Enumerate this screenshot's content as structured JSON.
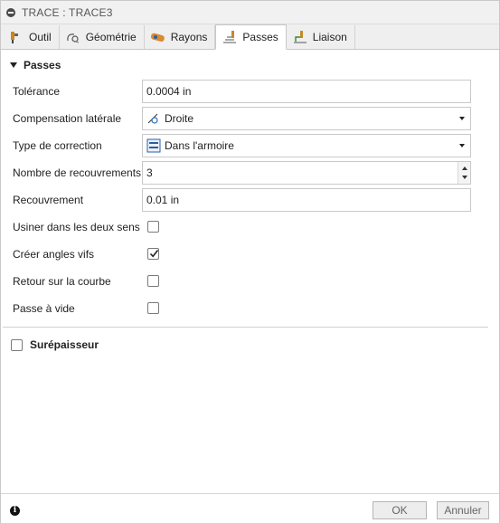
{
  "window": {
    "title": "TRACE : TRACE3"
  },
  "tabs": [
    {
      "label": "Outil",
      "icon": "tool-icon"
    },
    {
      "label": "Géométrie",
      "icon": "geometry-icon"
    },
    {
      "label": "Rayons",
      "icon": "radius-icon"
    },
    {
      "label": "Passes",
      "icon": "passes-icon",
      "active": true
    },
    {
      "label": "Liaison",
      "icon": "linking-icon"
    }
  ],
  "section": {
    "title": "Passes",
    "expanded": true
  },
  "fields": {
    "tolerance": {
      "label": "Tolérance",
      "value": "0.0004 in"
    },
    "compensation": {
      "label": "Compensation latérale",
      "value": "Droite",
      "icon": "compensation-right-icon"
    },
    "correction_type": {
      "label": "Type de correction",
      "value": "Dans l'armoire",
      "icon": "control-cabinet-icon"
    },
    "overlap_count": {
      "label": "Nombre de recouvrements",
      "value": "3"
    },
    "overlap": {
      "label": "Recouvrement",
      "value": "0.01 in"
    }
  },
  "checkboxes": {
    "both_ways": {
      "label": "Usiner dans les deux sens",
      "checked": false
    },
    "sharp_corners": {
      "label": "Créer angles vifs",
      "checked": true
    },
    "back_on_curve": {
      "label": "Retour sur la courbe",
      "checked": false
    },
    "empty_pass": {
      "label": "Passe à vide",
      "checked": false
    }
  },
  "stock_section": {
    "label": "Surépaisseur",
    "checked": false
  },
  "footer": {
    "ok_label": "OK",
    "cancel_label": "Annuler",
    "info_glyph": "i"
  }
}
